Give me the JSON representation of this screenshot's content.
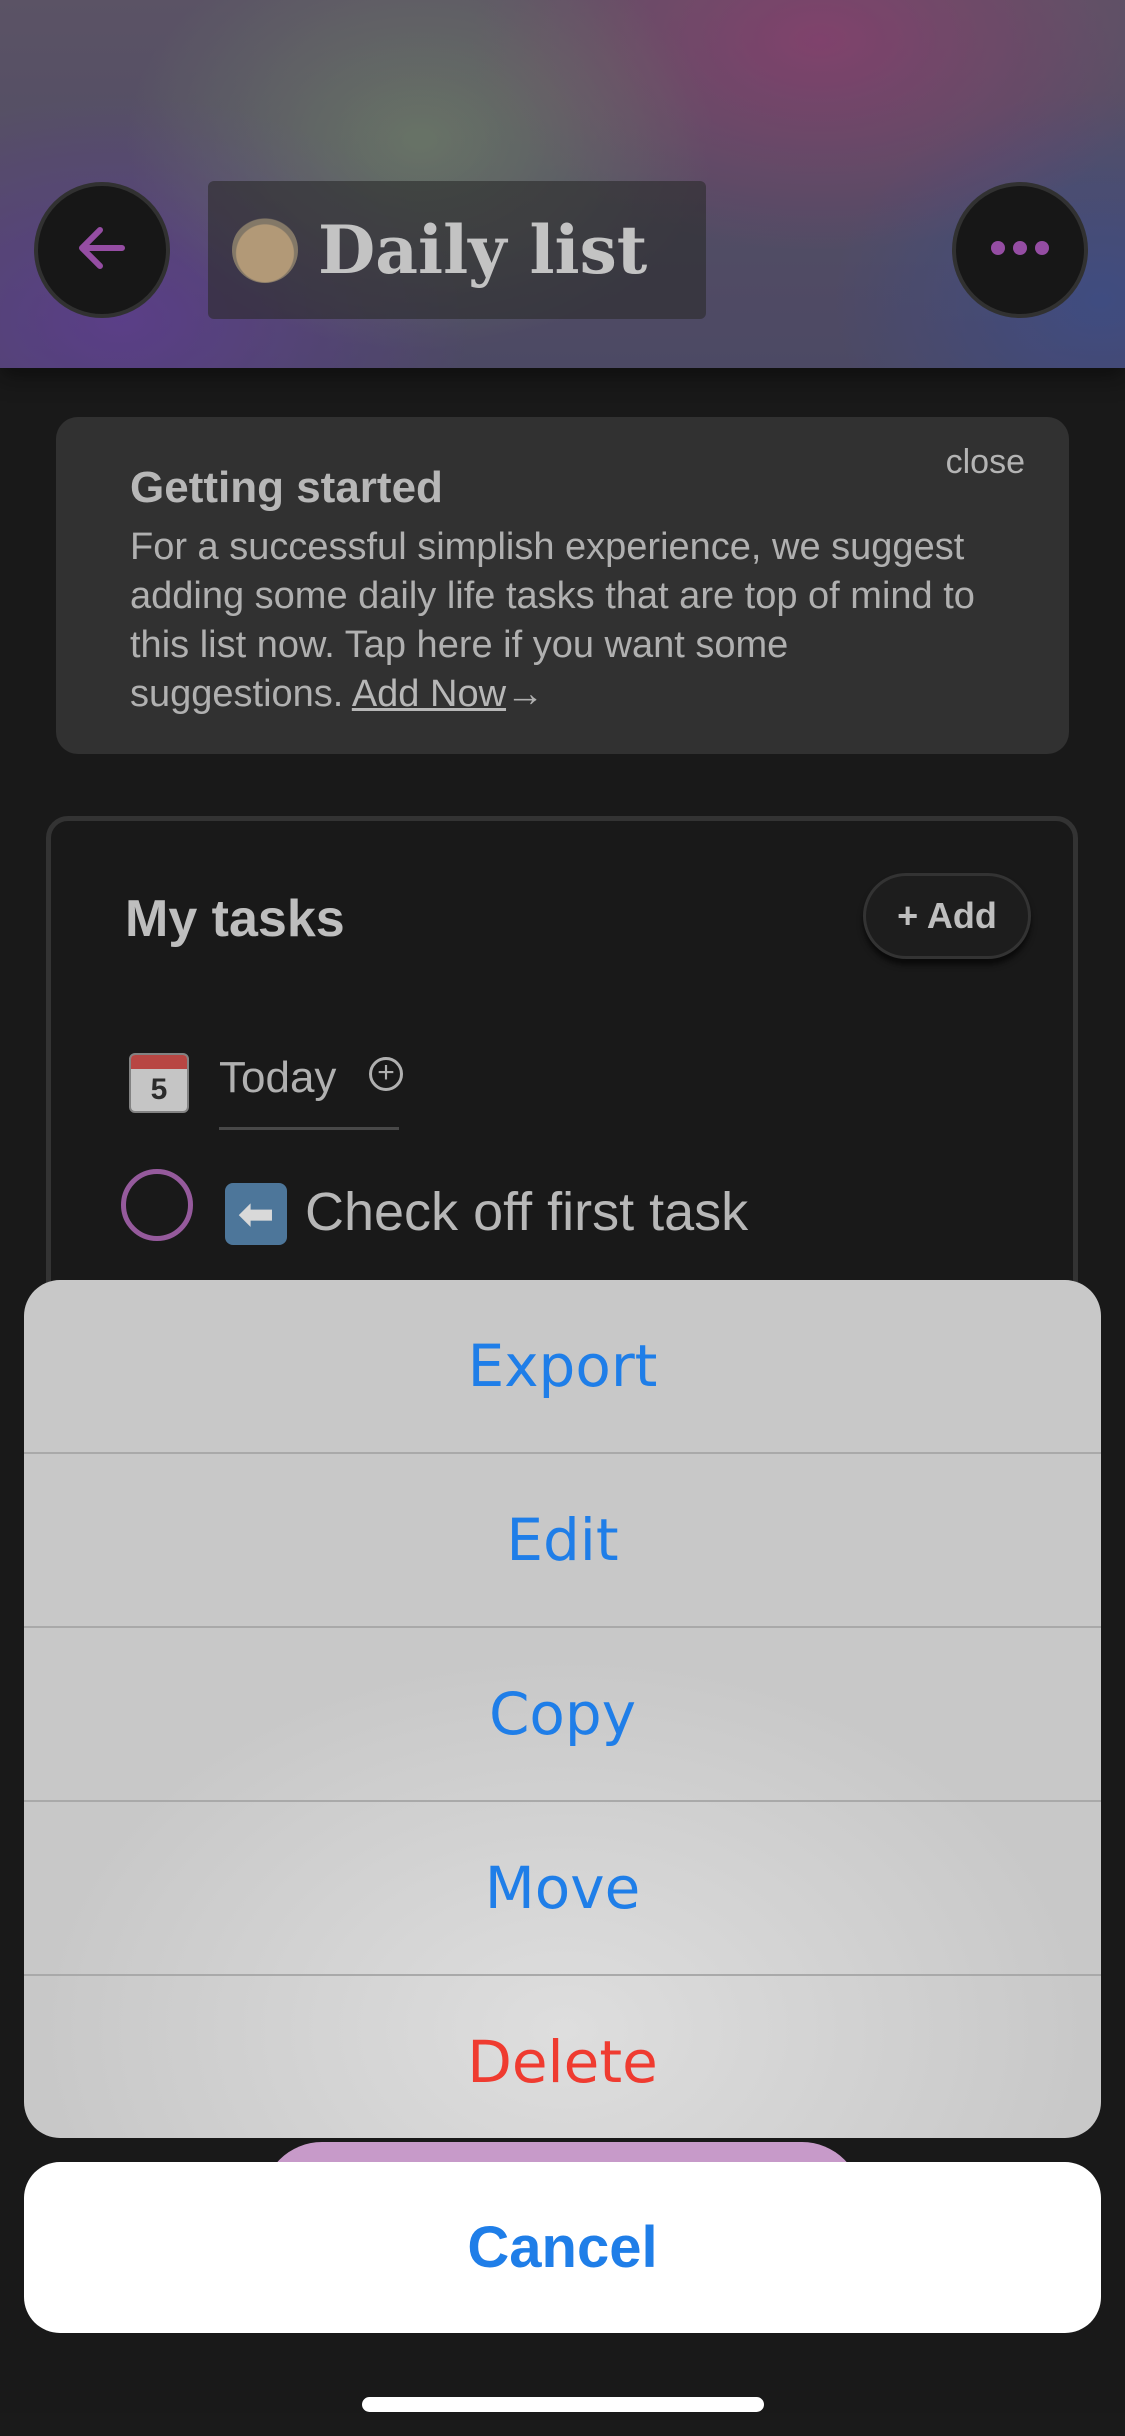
{
  "header": {
    "title": "Daily list",
    "back_icon": "arrow-left-icon",
    "more_icon": "ellipsis-icon",
    "accent_color": "#b05bc0"
  },
  "getting_started": {
    "close_label": "close",
    "title": "Getting started",
    "body": "For a successful simplish experience, we suggest adding some daily life tasks that are top of mind to this list now.  Tap here if you want some suggestions. ",
    "link_label": "Add Now",
    "link_arrow": "→"
  },
  "tasks": {
    "title": "My tasks",
    "add_label": "+ Add",
    "section_day": "5",
    "section_label": "Today",
    "section_add": "+",
    "items": [
      {
        "emoji": "⬅",
        "label": "Check off first task"
      }
    ]
  },
  "action_sheet": {
    "items": [
      {
        "label": "Export",
        "color": "#1f7ee8"
      },
      {
        "label": "Edit",
        "color": "#1f7ee8"
      },
      {
        "label": "Copy",
        "color": "#1f7ee8"
      },
      {
        "label": "Move",
        "color": "#1f7ee8"
      },
      {
        "label": "Delete",
        "color": "#ef3b30"
      }
    ],
    "cancel_label": "Cancel"
  }
}
